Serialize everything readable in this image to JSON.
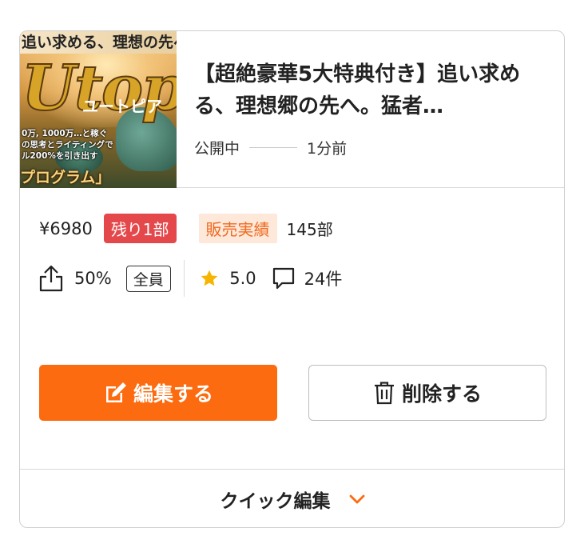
{
  "product": {
    "thumbnail": {
      "banner_text": "追い求める、理想の先へ",
      "big_text": "Utopia",
      "kana_text": "ユートピア",
      "line1": "0万, 1000万…と稼ぐ",
      "line2": "の思考とライティングで",
      "line3": "ル200%を引き出す",
      "program_text": "プログラム」"
    },
    "title": "【超絶豪華5大特典付き】追い求める、理想郷の先へ。猛者…",
    "status": "公開中",
    "time_ago": "1分前"
  },
  "stats": {
    "price": "¥6980",
    "stock_badge": "残り1部",
    "sales_label": "販売実績",
    "sales_count": "145部",
    "affiliate_rate": "50%",
    "audience_badge": "全員",
    "rating": "5.0",
    "comments": "24件"
  },
  "actions": {
    "edit_label": "編集する",
    "delete_label": "削除する"
  },
  "footer": {
    "quick_edit_label": "クイック編集"
  },
  "colors": {
    "accent": "#fc6b0f",
    "stock_badge_bg": "#e4484b",
    "sales_badge_bg": "#fde8da",
    "sales_badge_text": "#f06a20",
    "star": "#f6b500"
  }
}
